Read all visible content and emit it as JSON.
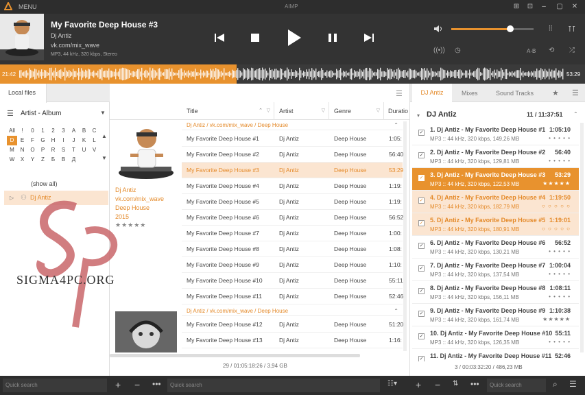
{
  "window": {
    "menu_label": "MENU",
    "title": "AIMP"
  },
  "now_playing": {
    "title": "My Favorite Deep House #3",
    "artist": "Dj Antiz",
    "album": "vk.com/mix_wave",
    "format": "MP3, 44 kHz, 320 kbps, Stereo",
    "volume": 0.72,
    "ab_label": "A-B"
  },
  "wave": {
    "elapsed": "21:42",
    "remaining": "53:29",
    "progress": 0.405
  },
  "left_panel": {
    "tab_label": "Local files",
    "grouping_label": "Artist - Album",
    "alphabet": [
      "All",
      "!",
      "0",
      "1",
      "2",
      "3",
      "A",
      "B",
      "C",
      "D",
      "E",
      "F",
      "G",
      "H",
      "I",
      "J",
      "K",
      "L",
      "M",
      "N",
      "O",
      "P",
      "R",
      "S",
      "T",
      "U",
      "V",
      "W",
      "X",
      "Y",
      "Z",
      "Б",
      "В",
      "Д"
    ],
    "alphabet_selected": "D",
    "show_all": "(show all)",
    "tree_item": "Dj Antiz"
  },
  "middle_panel": {
    "columns": [
      "Title",
      "Artist",
      "Genre",
      "Duratio"
    ],
    "group1": {
      "header": "Dj Antiz / vk.com/mix_wave / Deep House",
      "artist": "Dj Antiz",
      "album": "vk.com/mix_wave",
      "genre": "Deep House",
      "year": "2015",
      "rating": "★★★★★"
    },
    "rows": [
      {
        "title": "My Favorite Deep House #1",
        "artist": "Dj Antiz",
        "genre": "Deep House",
        "duration": "1:05:"
      },
      {
        "title": "My Favorite Deep House #2",
        "artist": "Dj Antiz",
        "genre": "Deep House",
        "duration": "56:40"
      },
      {
        "title": "My Favorite Deep House #3",
        "artist": "Dj Antiz",
        "genre": "Deep House",
        "duration": "53:29"
      },
      {
        "title": "My Favorite Deep House #4",
        "artist": "Dj Antiz",
        "genre": "Deep House",
        "duration": "1:19:"
      },
      {
        "title": "My Favorite Deep House #5",
        "artist": "Dj Antiz",
        "genre": "Deep House",
        "duration": "1:19:"
      },
      {
        "title": "My Favorite Deep House #6",
        "artist": "Dj Antiz",
        "genre": "Deep House",
        "duration": "56:52"
      },
      {
        "title": "My Favorite Deep House #7",
        "artist": "Dj Antiz",
        "genre": "Deep House",
        "duration": "1:00:"
      },
      {
        "title": "My Favorite Deep House #8",
        "artist": "Dj Antiz",
        "genre": "Deep House",
        "duration": "1:08:"
      },
      {
        "title": "My Favorite Deep House #9",
        "artist": "Dj Antiz",
        "genre": "Deep House",
        "duration": "1:10:"
      },
      {
        "title": "My Favorite Deep House #10",
        "artist": "Dj Antiz",
        "genre": "Deep House",
        "duration": "55:11"
      },
      {
        "title": "My Favorite Deep House #11",
        "artist": "Dj Antiz",
        "genre": "Deep House",
        "duration": "52:46"
      }
    ],
    "group2_header": "Dj Antiz / vk.com/mix_wave / Deep House",
    "rows2": [
      {
        "title": "My Favorite Deep House #12",
        "artist": "Dj Antiz",
        "genre": "Deep House",
        "duration": "51:20"
      },
      {
        "title": "My Favorite Deep House #13",
        "artist": "Dj Antiz",
        "genre": "Deep House",
        "duration": "1:16:"
      }
    ],
    "status": "29 / 01:05:18:26 / 3,94 GB"
  },
  "right_panel": {
    "tabs": [
      "DJ Antiz",
      "Mixes",
      "Sound Tracks"
    ],
    "playlist_title": "DJ Antiz",
    "playlist_summary": "11 / 11:37:51",
    "items": [
      {
        "title": "1. Dj Antiz - My Favorite Deep House #1",
        "info": "MP3 :: 44 kHz, 320 kbps, 149,26 MB",
        "duration": "1:05:10",
        "rating": "• • • • •"
      },
      {
        "title": "2. Dj Antiz - My Favorite Deep House #2",
        "info": "MP3 :: 44 kHz, 320 kbps, 129,81 MB",
        "duration": "56:40",
        "rating": "• • • • •"
      },
      {
        "title": "3. Dj Antiz - My Favorite Deep House #3",
        "info": "MP3 :: 44 kHz, 320 kbps, 122,53 MB",
        "duration": "53:29",
        "rating": "★★★★★"
      },
      {
        "title": "4. Dj Antiz - My Favorite Deep House #4",
        "info": "MP3 :: 44 kHz, 320 kbps, 182,79 MB",
        "duration": "1:19:50",
        "rating": "○ ○ ○ ○ ○"
      },
      {
        "title": "5. Dj Antiz - My Favorite Deep House #5",
        "info": "MP3 :: 44 kHz, 320 kbps, 180,91 MB",
        "duration": "1:19:01",
        "rating": "○ ○ ○ ○ ○"
      },
      {
        "title": "6. Dj Antiz - My Favorite Deep House #6",
        "info": "MP3 :: 44 kHz, 320 kbps, 130,21 MB",
        "duration": "56:52",
        "rating": "• • • • •"
      },
      {
        "title": "7. Dj Antiz - My Favorite Deep House #7",
        "info": "MP3 :: 44 kHz, 320 kbps, 137,54 MB",
        "duration": "1:00:04",
        "rating": "• • • • •"
      },
      {
        "title": "8. Dj Antiz - My Favorite Deep House #8",
        "info": "MP3 :: 44 kHz, 320 kbps, 156,11 MB",
        "duration": "1:08:11",
        "rating": "• • • • •"
      },
      {
        "title": "9. Dj Antiz - My Favorite Deep House #9",
        "info": "MP3 :: 44 kHz, 320 kbps, 161,74 MB",
        "duration": "1:10:38",
        "rating": "★★★★★"
      },
      {
        "title": "10. Dj Antiz - My Favorite Deep House #10",
        "info": "MP3 :: 44 kHz, 320 kbps, 126,35 MB",
        "duration": "55:11",
        "rating": "• • • • •"
      },
      {
        "title": "11. Dj Antiz - My Favorite Deep House #11",
        "info": "",
        "duration": "52:46",
        "rating": ""
      }
    ],
    "status": "3 / 00:03:32:20 / 486,23 MB"
  },
  "bottom": {
    "search_left": "Quick search",
    "search_mid": "Quick search",
    "search_right": "Quick search"
  },
  "watermark": {
    "text": "SIGMA4PC.ORG"
  },
  "colors": {
    "accent": "#e8922e",
    "dark": "#2d2d2d"
  }
}
